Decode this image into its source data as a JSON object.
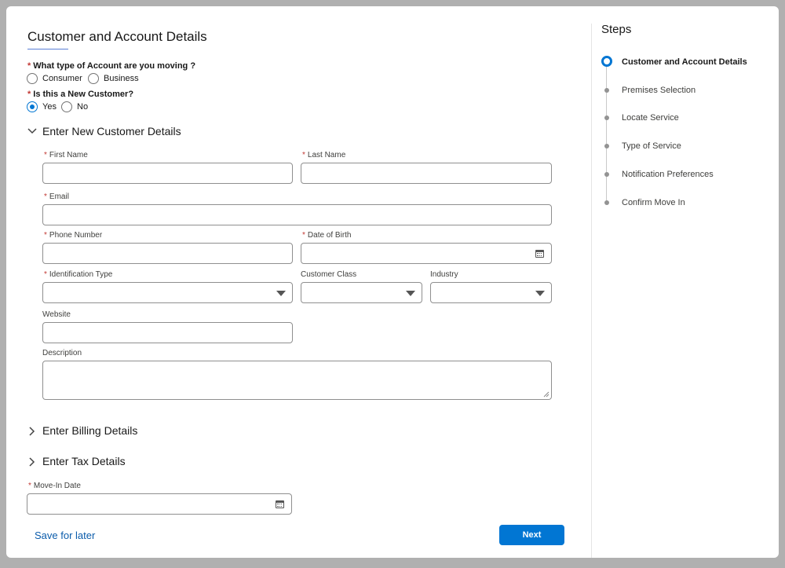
{
  "form": {
    "title": "Customer and Account Details",
    "account_type_question": "What type of Account are you moving ?",
    "account_type_options": [
      "Consumer",
      "Business"
    ],
    "new_customer_question": "Is this a New Customer?",
    "new_customer_options": [
      "Yes",
      "No"
    ],
    "new_customer_selected": "Yes",
    "sections": {
      "new_customer": "Enter New Customer Details",
      "billing": "Enter Billing Details",
      "tax": "Enter Tax Details"
    },
    "fields": {
      "first_name": "First Name",
      "last_name": "Last Name",
      "email": "Email",
      "phone": "Phone Number",
      "dob": "Date of Birth",
      "id_type": "Identification Type",
      "customer_class": "Customer Class",
      "industry": "Industry",
      "website": "Website",
      "description": "Description",
      "move_in_date": "Move-In Date"
    },
    "required_marker": "*",
    "save_for_later": "Save for later",
    "next": "Next"
  },
  "steps": {
    "title": "Steps",
    "items": [
      "Customer and Account Details",
      "Premises Selection",
      "Locate Service",
      "Type of Service",
      "Notification Preferences",
      "Confirm Move In"
    ]
  },
  "colors": {
    "accent": "#0176d3",
    "link": "#0b5cab",
    "required": "#c23934"
  }
}
